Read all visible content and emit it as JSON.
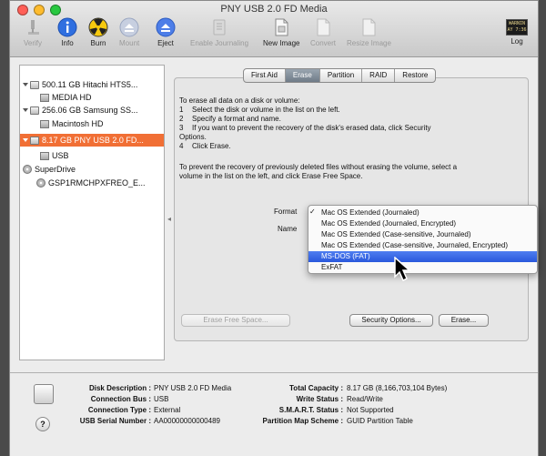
{
  "window": {
    "title": "PNY USB 2.0 FD Media"
  },
  "toolbar": {
    "verify": "Verify",
    "info": "Info",
    "burn": "Burn",
    "mount": "Mount",
    "eject": "Eject",
    "enable_journaling": "Enable Journaling",
    "new_image": "New Image",
    "convert": "Convert",
    "resize_image": "Resize Image",
    "log": "Log",
    "log_badge_line1": "WARNIN",
    "log_badge_line2": "AY 7:36"
  },
  "sidebar": {
    "items": [
      {
        "label": "500.11 GB Hitachi HTS5..."
      },
      {
        "label": "MEDIA HD"
      },
      {
        "label": "256.06 GB Samsung SS..."
      },
      {
        "label": "Macintosh HD"
      },
      {
        "label": "8.17 GB PNY USB 2.0 FD..."
      },
      {
        "label": "USB"
      },
      {
        "label": "SuperDrive"
      },
      {
        "label": "GSP1RMCHPXFREO_E..."
      }
    ]
  },
  "tabs": [
    "First Aid",
    "Erase",
    "Partition",
    "RAID",
    "Restore"
  ],
  "erase": {
    "intro": "To erase all data on a disk or volume:",
    "steps": [
      {
        "n": "1",
        "text": "Select the disk or volume in the list on the left."
      },
      {
        "n": "2",
        "text": "Specify a format and name."
      },
      {
        "n": "3",
        "text": "If you want to prevent the recovery of the disk's erased data, click Security"
      },
      {
        "n": "4",
        "text": "Click Erase."
      }
    ],
    "options_word": "Options.",
    "free_space_line1": "To prevent the recovery of previously deleted files without erasing the volume, select a",
    "free_space_line2": "volume in the list on the left, and click Erase Free Space.",
    "format_label": "Format",
    "name_label": "Name",
    "format_options": [
      "Mac OS Extended (Journaled)",
      "Mac OS Extended (Journaled, Encrypted)",
      "Mac OS Extended (Case-sensitive, Journaled)",
      "Mac OS Extended (Case-sensitive, Journaled, Encrypted)",
      "MS-DOS (FAT)",
      "ExFAT"
    ],
    "checked_mark": "✓",
    "erase_free_space_button": "Erase Free Space...",
    "security_options_button": "Security Options...",
    "erase_button": "Erase..."
  },
  "info": {
    "left": [
      {
        "k": "Disk Description :",
        "v": "PNY USB 2.0 FD Media"
      },
      {
        "k": "Connection Bus :",
        "v": "USB"
      },
      {
        "k": "Connection Type :",
        "v": "External"
      },
      {
        "k": "USB Serial Number :",
        "v": "AA00000000000489"
      }
    ],
    "right": [
      {
        "k": "Total Capacity :",
        "v": "8.17 GB (8,166,703,104 Bytes)"
      },
      {
        "k": "Write Status :",
        "v": "Read/Write"
      },
      {
        "k": "S.M.A.R.T. Status :",
        "v": "Not Supported"
      },
      {
        "k": "Partition Map Scheme :",
        "v": "GUID Partition Table"
      }
    ],
    "help": "?"
  },
  "colors": {
    "selection": "#f16f35",
    "menu_highlight": "#2958dc"
  }
}
